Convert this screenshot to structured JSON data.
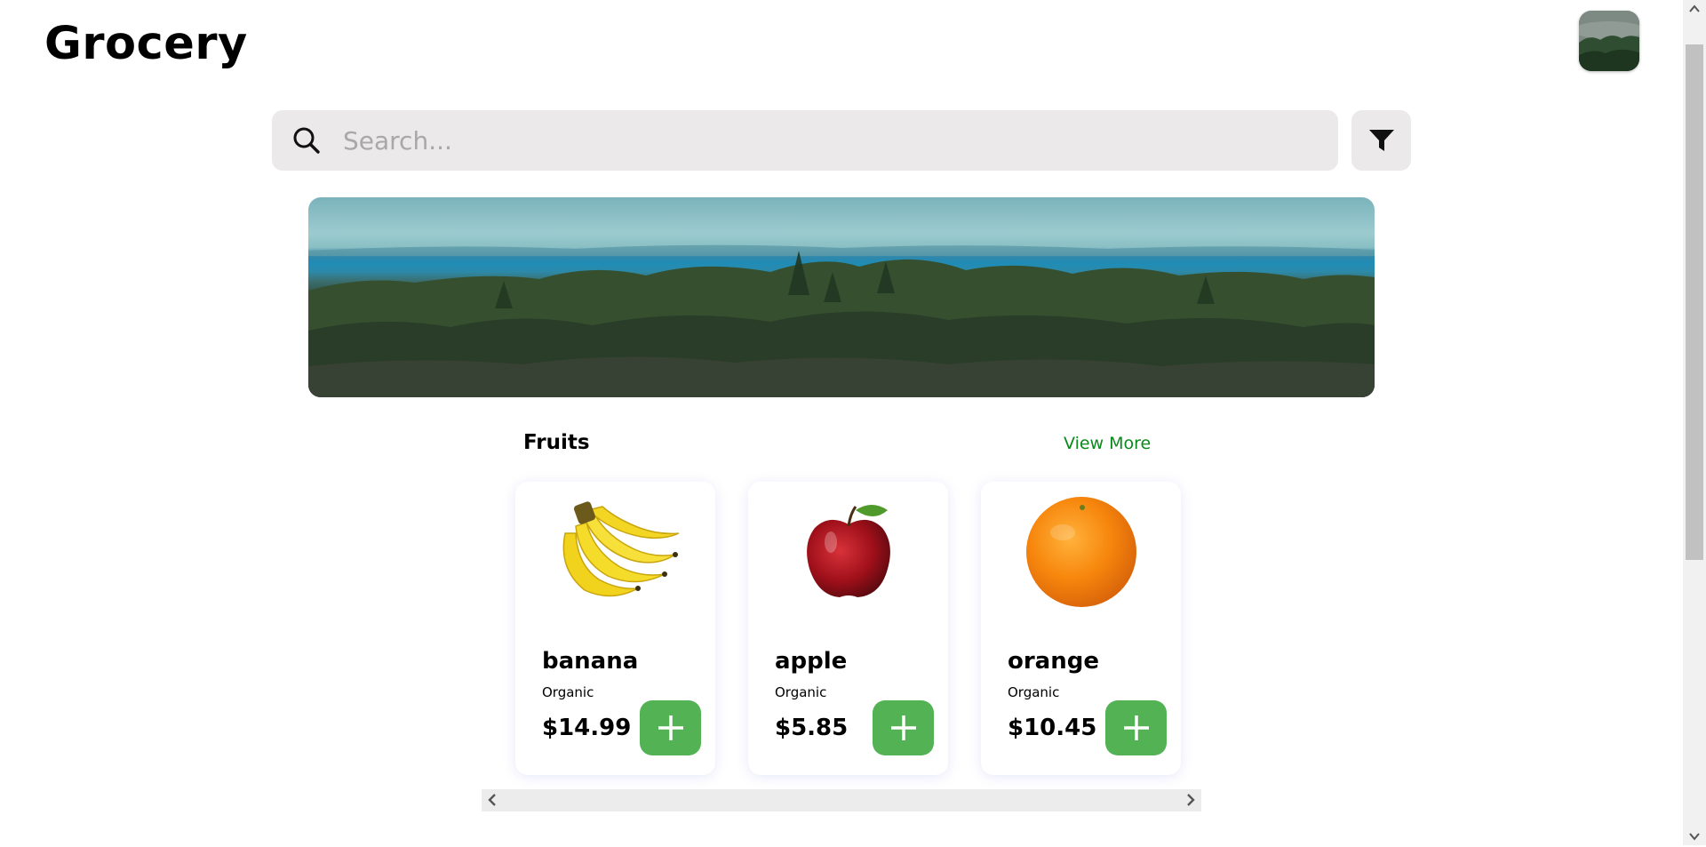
{
  "header": {
    "title": "Grocery",
    "avatar_icon": "user-avatar"
  },
  "search": {
    "placeholder": "Search...",
    "value": "",
    "icon": "search-icon",
    "filter_icon": "filter-icon"
  },
  "banner": {
    "icon": "landscape-banner-image"
  },
  "section": {
    "title": "Fruits",
    "view_more": "View More"
  },
  "products": [
    {
      "name": "banana",
      "tag": "Organic",
      "price": "$14.99",
      "icon": "banana-image"
    },
    {
      "name": "apple",
      "tag": "Organic",
      "price": "$5.85",
      "icon": "apple-image"
    },
    {
      "name": "orange",
      "tag": "Organic",
      "price": "$10.45",
      "icon": "orange-image"
    }
  ],
  "colors": {
    "accent_green": "#53b354",
    "link_green": "#0a8a1a",
    "search_bg": "#ebe9ea"
  }
}
